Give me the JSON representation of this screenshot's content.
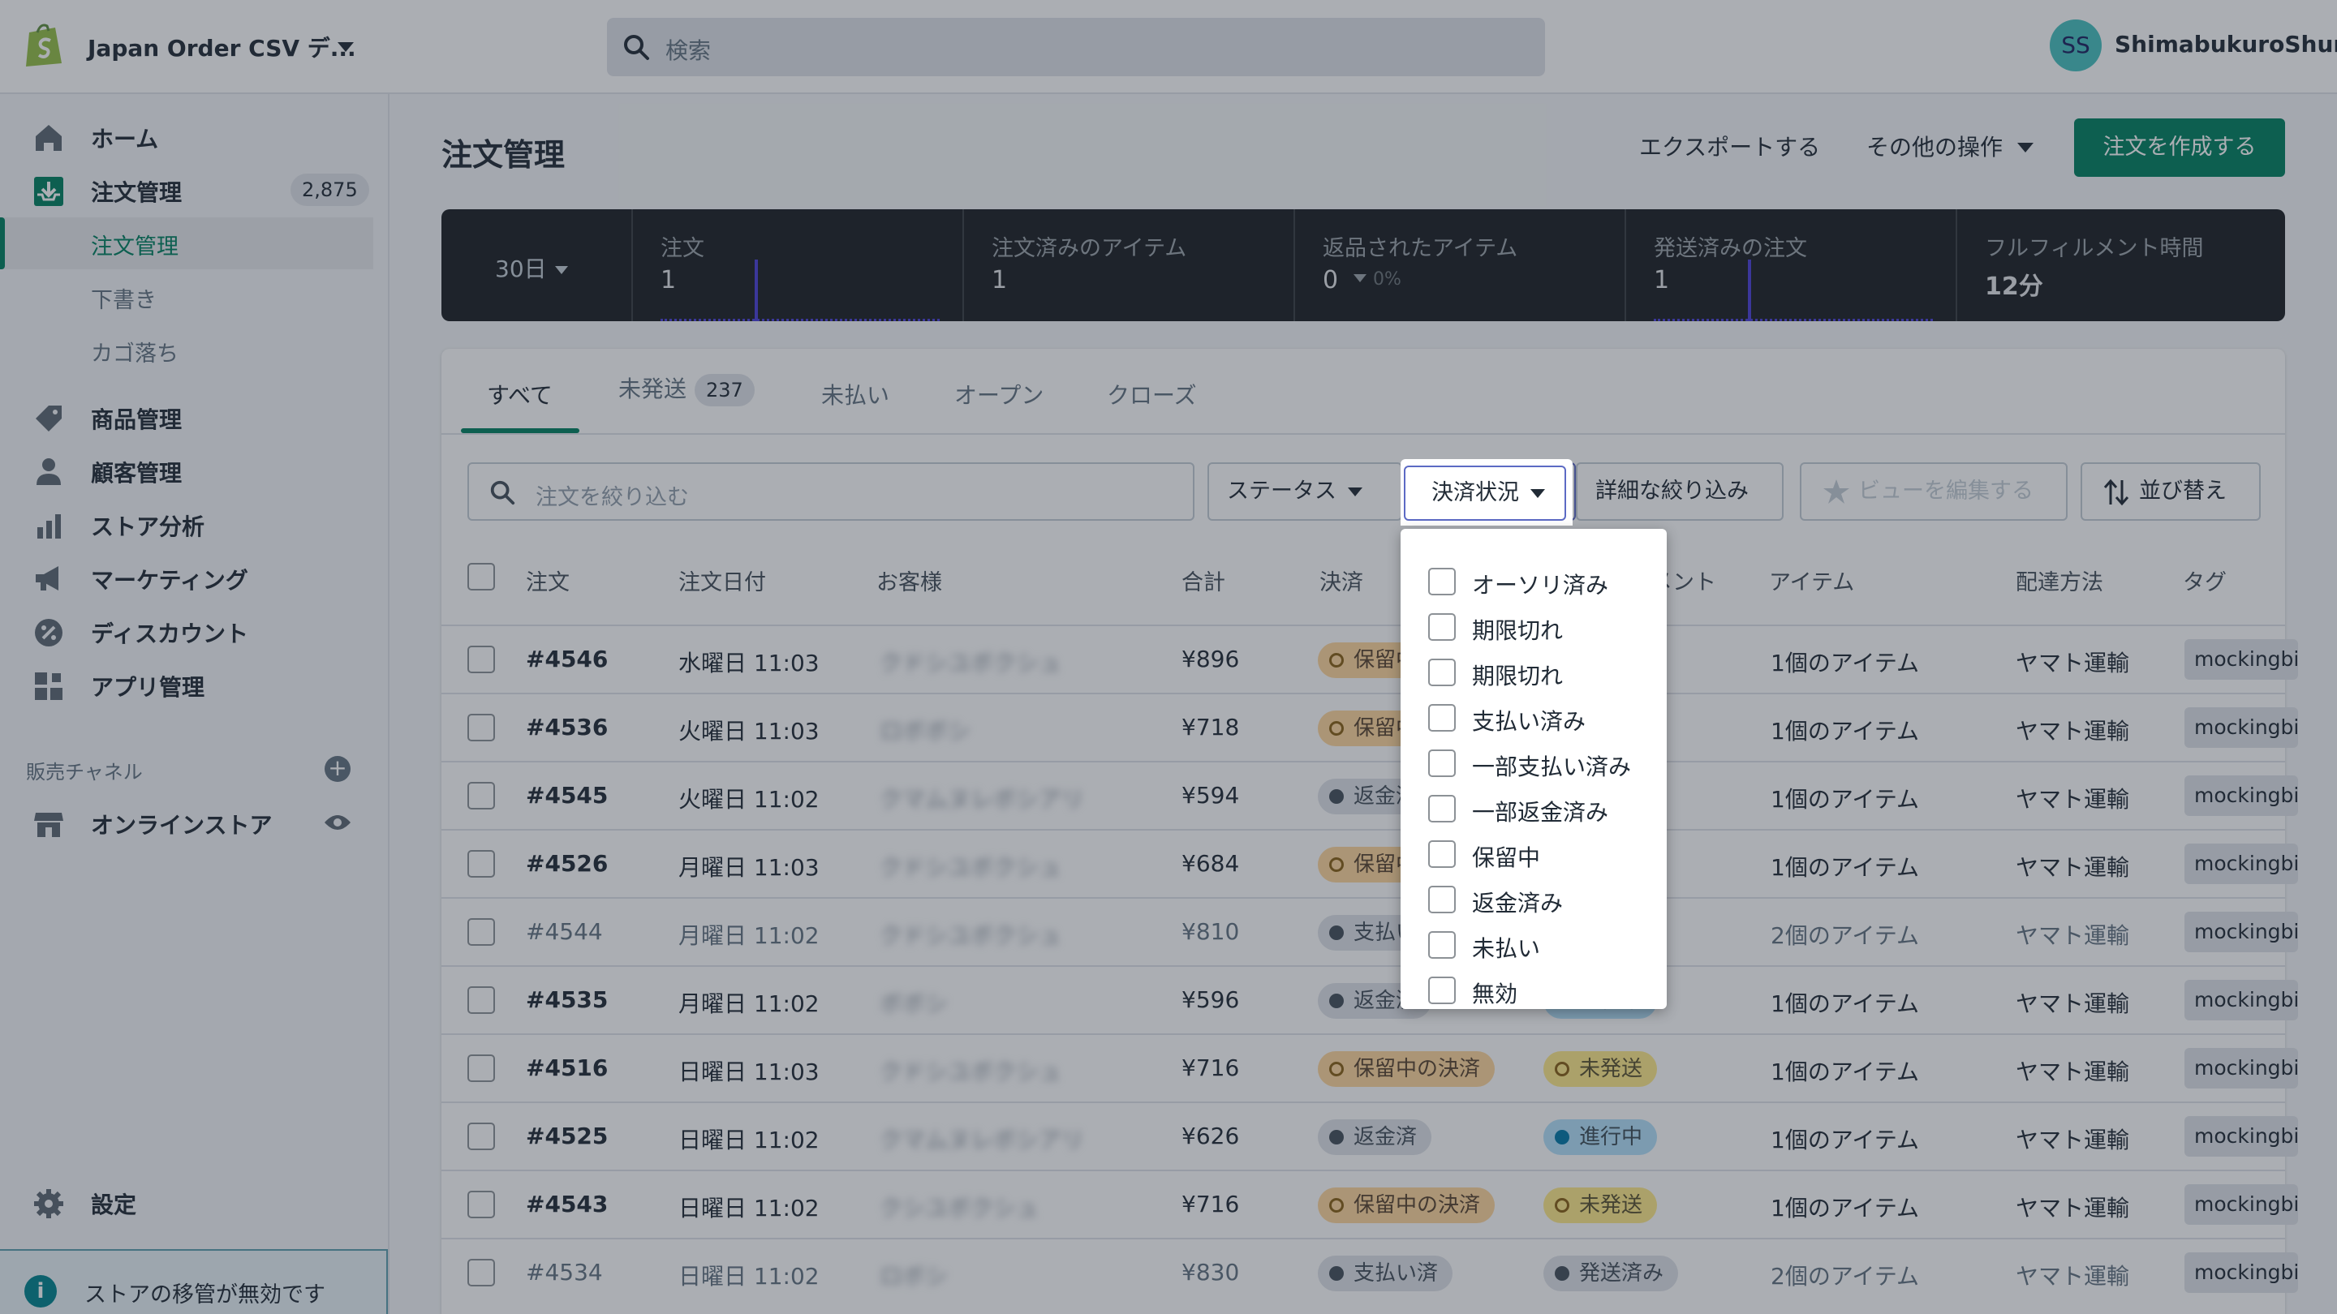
{
  "topbar": {
    "store_name": "Japan Order CSV デ...",
    "search_placeholder": "検索",
    "avatar_initials": "SS",
    "user_name": "ShimabukuroShun"
  },
  "sidebar": {
    "items": [
      {
        "label": "ホーム",
        "icon": "home-icon"
      },
      {
        "label": "注文管理",
        "icon": "orders-icon",
        "count": "2,875"
      },
      {
        "label": "商品管理",
        "icon": "tag-icon"
      },
      {
        "label": "顧客管理",
        "icon": "person-icon"
      },
      {
        "label": "ストア分析",
        "icon": "bar-chart-icon"
      },
      {
        "label": "マーケティング",
        "icon": "megaphone-icon"
      },
      {
        "label": "ディスカウント",
        "icon": "discount-icon"
      },
      {
        "label": "アプリ管理",
        "icon": "apps-icon"
      }
    ],
    "sub_items": [
      "注文管理",
      "下書き",
      "カゴ落ち"
    ],
    "channels_heading": "販売チャネル",
    "online_store": "オンラインストア",
    "settings": "設定",
    "notice": "ストアの移管が無効です"
  },
  "header": {
    "title": "注文管理",
    "export": "エクスポートする",
    "more_actions": "その他の操作",
    "create": "注文を作成する"
  },
  "stats": {
    "range": "30日",
    "cards": [
      {
        "title": "注文",
        "value": "1"
      },
      {
        "title": "注文済みのアイテム",
        "value": "1"
      },
      {
        "title": "返品されたアイテム",
        "value": "0",
        "delta": "0%"
      },
      {
        "title": "発送済みの注文",
        "value": "1"
      },
      {
        "title": "フルフィルメント時間",
        "value": "12分"
      }
    ]
  },
  "tabs": {
    "all": "すべて",
    "unfulfilled": "未発送",
    "unfulfilled_count": "237",
    "unpaid": "未払い",
    "open": "オープン",
    "closed": "クローズ"
  },
  "filters": {
    "search_placeholder": "注文を絞り込む",
    "status": "ステータス",
    "payment_status": "決済状況",
    "more_filters": "詳細な絞り込み",
    "edit_view": "ビューを編集する",
    "sort": "並び替え"
  },
  "table": {
    "headers": {
      "order": "注文",
      "date": "注文日付",
      "customer": "お客様",
      "total": "合計",
      "payment": "決済",
      "fulfillment_partial": "メント",
      "items": "アイテム",
      "delivery": "配達方法",
      "tags": "タグ"
    },
    "rows": [
      {
        "order": "#4546",
        "date": "水曜日 11:03",
        "customer": "クドシユボクシュ",
        "total": "¥896",
        "payment": "保留中",
        "payment_style": "orange",
        "fulfillment": "",
        "items": "1個のアイテム",
        "delivery": "ヤマト運輸",
        "tag": "mockingbird",
        "muted": false
      },
      {
        "order": "#4536",
        "date": "火曜日 11:03",
        "customer": "ロボボシ",
        "total": "¥718",
        "payment": "保留中",
        "payment_style": "orange",
        "fulfillment": "",
        "items": "1個のアイテム",
        "delivery": "ヤマト運輸",
        "tag": "mockingbird",
        "muted": false
      },
      {
        "order": "#4545",
        "date": "火曜日 11:02",
        "customer": "クマムヌレボシアリ",
        "total": "¥594",
        "payment": "返金済",
        "payment_style": "gray",
        "fulfillment": "",
        "items": "1個のアイテム",
        "delivery": "ヤマト運輸",
        "tag": "mockingbird",
        "muted": false
      },
      {
        "order": "#4526",
        "date": "月曜日 11:03",
        "customer": "クドシユボクシュ",
        "total": "¥684",
        "payment": "保留中",
        "payment_style": "orange",
        "fulfillment": "",
        "items": "1個のアイテム",
        "delivery": "ヤマト運輸",
        "tag": "mockingbird",
        "muted": false
      },
      {
        "order": "#4544",
        "date": "月曜日 11:02",
        "customer": "クドシユボクシュ",
        "total": "¥810",
        "payment": "支払い",
        "payment_style": "gray",
        "fulfillment": "",
        "items": "2個のアイテム",
        "delivery": "ヤマト運輸",
        "tag": "mockingbird",
        "muted": true
      },
      {
        "order": "#4535",
        "date": "月曜日 11:02",
        "customer": "ボボシ",
        "total": "¥596",
        "payment": "返金済",
        "payment_style": "gray",
        "fulfillment": "進行中",
        "fulfillment_style": "blue",
        "items": "1個のアイテム",
        "delivery": "ヤマト運輸",
        "tag": "mockingbird",
        "muted": false
      },
      {
        "order": "#4516",
        "date": "日曜日 11:03",
        "customer": "クドシユボクシュ",
        "total": "¥716",
        "payment": "保留中の決済",
        "payment_style": "orange",
        "fulfillment": "未発送",
        "fulfillment_style": "yellow",
        "items": "1個のアイテム",
        "delivery": "ヤマト運輸",
        "tag": "mockingbird",
        "muted": false
      },
      {
        "order": "#4525",
        "date": "日曜日 11:02",
        "customer": "クマムヌレボシアリ",
        "total": "¥626",
        "payment": "返金済",
        "payment_style": "gray",
        "fulfillment": "進行中",
        "fulfillment_style": "blue",
        "items": "1個のアイテム",
        "delivery": "ヤマト運輸",
        "tag": "mockingbird",
        "muted": false
      },
      {
        "order": "#4543",
        "date": "日曜日 11:02",
        "customer": "クシユボクシュ",
        "total": "¥716",
        "payment": "保留中の決済",
        "payment_style": "orange",
        "fulfillment": "未発送",
        "fulfillment_style": "yellow",
        "items": "1個のアイテム",
        "delivery": "ヤマト運輸",
        "tag": "mockingbird",
        "muted": false
      },
      {
        "order": "#4534",
        "date": "日曜日 11:02",
        "customer": "ロボシ",
        "total": "¥830",
        "payment": "支払い済",
        "payment_style": "gray",
        "fulfillment": "発送済み",
        "fulfillment_style": "gray",
        "items": "2個のアイテム",
        "delivery": "ヤマト運輸",
        "tag": "mockingbird",
        "muted": true
      }
    ]
  },
  "payment_dropdown": {
    "options": [
      "オーソリ済み",
      "期限切れ",
      "期限切れ",
      "支払い済み",
      "一部支払い済み",
      "一部返金済み",
      "保留中",
      "返金済み",
      "未払い",
      "無効"
    ]
  },
  "colors": {
    "primary": "#008060",
    "stats_bg": "#1c2024",
    "focus": "#5c6ac4"
  }
}
